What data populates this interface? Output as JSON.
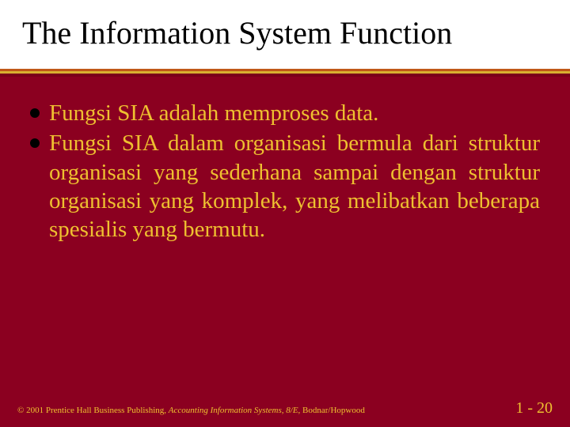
{
  "title": "The Information System Function",
  "bullets": [
    "Fungsi SIA adalah memproses data.",
    "Fungsi SIA dalam organisasi bermula dari struktur organisasi yang sederhana sampai dengan struktur organisasi yang komplek, yang melibatkan beberapa spesialis yang bermutu."
  ],
  "footer": {
    "copyright_prefix": "© 2001 Prentice Hall Business Publishing, ",
    "copyright_italic": "Accounting Information Systems, 8/E",
    "copyright_suffix": ", Bodnar/Hopwood",
    "page": "1 - 20"
  }
}
